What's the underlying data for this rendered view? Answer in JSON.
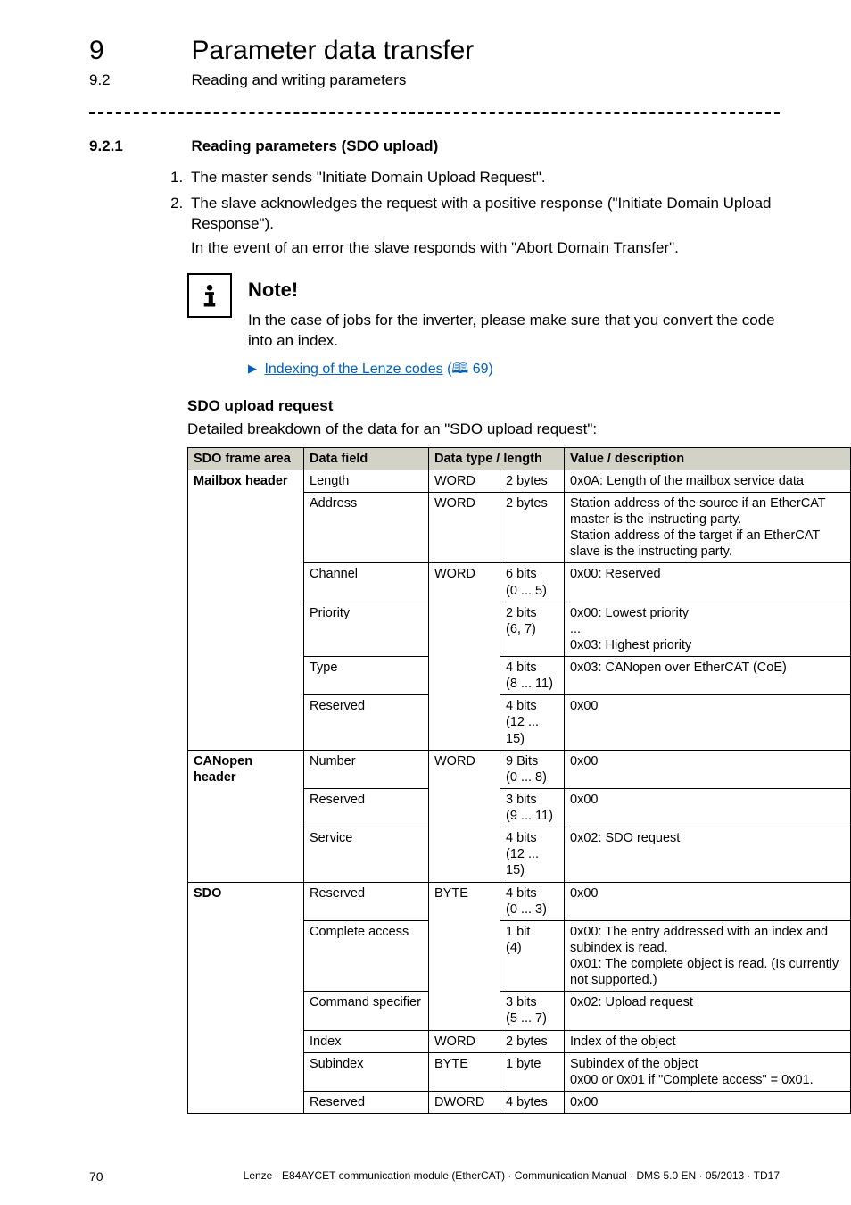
{
  "header": {
    "chapter_number": "9",
    "chapter_title": "Parameter data transfer",
    "section_number": "9.2",
    "section_title": "Reading and writing parameters"
  },
  "subsection": {
    "number": "9.2.1",
    "title": "Reading parameters (SDO upload)"
  },
  "steps": [
    {
      "text": "The master sends \"Initiate Domain Upload Request\"."
    },
    {
      "text": "The slave acknowledges the request with a positive response (\"Initiate Domain Upload Response\").",
      "sub": "In the event of an error the slave responds with \"Abort Domain Transfer\"."
    }
  ],
  "note": {
    "heading": "Note!",
    "body": "In the case of jobs for the inverter, please make sure that you convert the code into an index.",
    "link_text": "Indexing of the Lenze codes",
    "link_page": "69"
  },
  "request": {
    "heading": "SDO upload request",
    "para": "Detailed breakdown of the data for an \"SDO upload request\":"
  },
  "table": {
    "headers": [
      "SDO frame area",
      "Data field",
      "Data type / length",
      "",
      "Value / description"
    ],
    "groups": [
      {
        "area": "Mailbox header",
        "rows": [
          {
            "field": "Length",
            "type": "WORD",
            "len": "2 bytes",
            "val": "0x0A: Length of the mailbox service data"
          },
          {
            "field": "Address",
            "type": "WORD",
            "len": "2 bytes",
            "val": "Station address of the source if an EtherCAT master is the instructing party.\nStation address of the target if an EtherCAT slave is the instructing party."
          },
          {
            "field": "Channel",
            "type": "WORD",
            "type_rowspan": 4,
            "len": "6 bits\n(0 ... 5)",
            "val": "0x00: Reserved"
          },
          {
            "field": "Priority",
            "len": "2 bits\n(6, 7)",
            "val": "0x00: Lowest priority\n...\n0x03: Highest priority"
          },
          {
            "field": "Type",
            "len": "4 bits\n(8 ... 11)",
            "val": "0x03: CANopen over EtherCAT (CoE)"
          },
          {
            "field": "Reserved",
            "len": "4 bits\n(12 ... 15)",
            "val": "0x00"
          }
        ]
      },
      {
        "area": "CANopen header",
        "rows": [
          {
            "field": "Number",
            "type": "WORD",
            "type_rowspan": 3,
            "len": "9 Bits\n(0 ... 8)",
            "val": "0x00"
          },
          {
            "field": "Reserved",
            "len": "3 bits\n(9 ... 11)",
            "val": "0x00"
          },
          {
            "field": "Service",
            "len": "4 bits\n(12 ... 15)",
            "val": "0x02: SDO request"
          }
        ]
      },
      {
        "area": "SDO",
        "rows": [
          {
            "field": "Reserved",
            "type": "BYTE",
            "type_rowspan": 3,
            "len": "4 bits\n(0 ... 3)",
            "val": "0x00"
          },
          {
            "field": "Complete access",
            "len": "1 bit\n(4)",
            "val": "0x00: The entry addressed with an index and subindex is read.\n0x01: The complete object is read. (Is currently not supported.)"
          },
          {
            "field": "Command specifier",
            "len": "3 bits\n(5 ... 7)",
            "val": "0x02: Upload request"
          },
          {
            "field": "Index",
            "type": "WORD",
            "len": "2 bytes",
            "val": "Index of the object"
          },
          {
            "field": "Subindex",
            "type": "BYTE",
            "len": "1 byte",
            "val": "Subindex of the object\n0x00 or 0x01 if \"Complete access\" = 0x01."
          },
          {
            "field": "Reserved",
            "type": "DWORD",
            "len": "4 bytes",
            "val": "0x00"
          }
        ]
      }
    ]
  },
  "footer": {
    "page": "70",
    "line": "Lenze · E84AYCET communication module (EtherCAT) · Communication Manual · DMS 5.0 EN · 05/2013 · TD17"
  }
}
